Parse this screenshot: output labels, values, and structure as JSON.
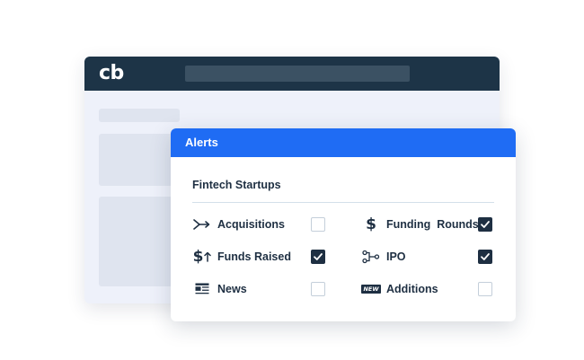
{
  "app": {
    "logo_text": "cb"
  },
  "alerts": {
    "title": "Alerts",
    "section_title": "Fintech Startups",
    "items": [
      {
        "label": "Acquisitions",
        "icon": "merge-arrow-icon",
        "checked": false
      },
      {
        "label": "Funding  Rounds",
        "icon": "dollar-icon",
        "checked": true
      },
      {
        "label": "Funds Raised",
        "icon": "dollar-up-arrow-icon",
        "checked": true
      },
      {
        "label": "IPO",
        "icon": "ipo-nodes-icon",
        "checked": true
      },
      {
        "label": "News",
        "icon": "newspaper-icon",
        "checked": false
      },
      {
        "label": "Additions",
        "icon": "new-badge-icon",
        "icon_text": "NEW",
        "checked": false
      }
    ]
  },
  "colors": {
    "header_dark": "#1d3447",
    "alerts_blue": "#1f6cf4",
    "text_dark": "#1e2f42",
    "checkbox_checked": "#1e2f42"
  }
}
